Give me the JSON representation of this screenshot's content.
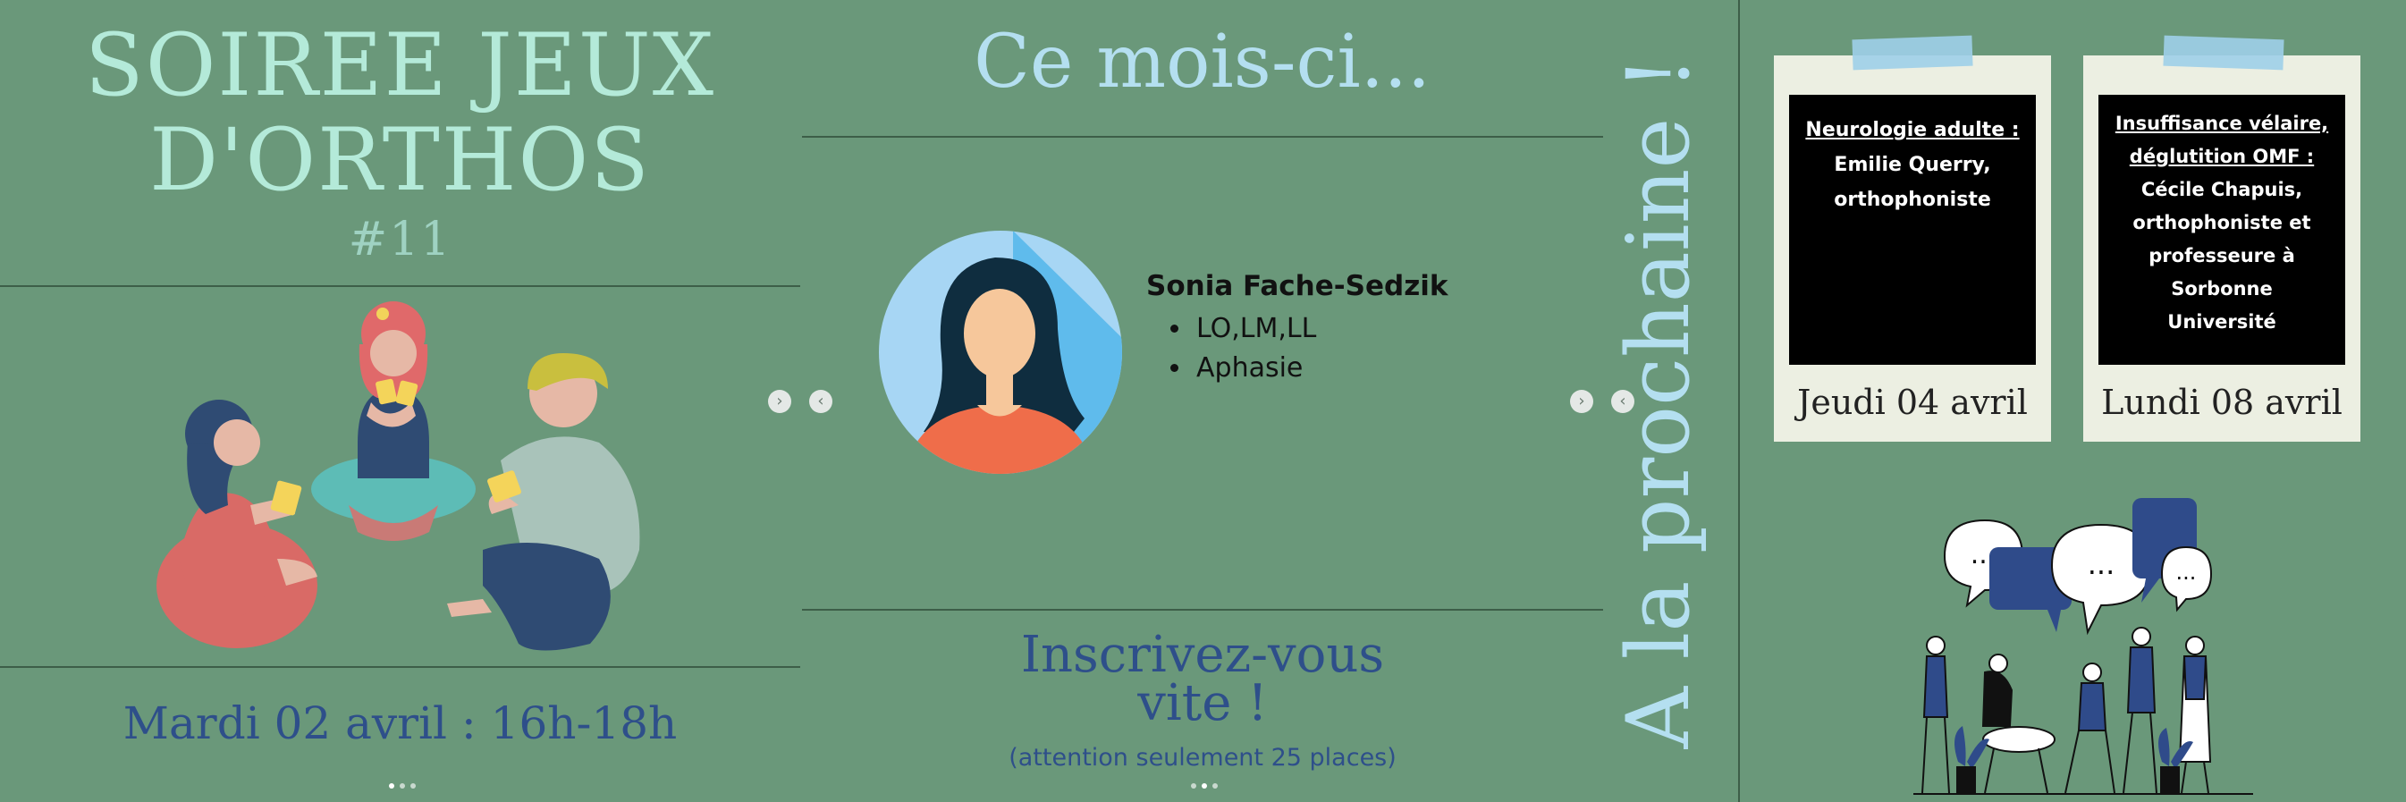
{
  "left_panel": {
    "title_line1": "SOIREE JEUX",
    "title_line2": "D'ORTHOS",
    "issue": "#11",
    "date": "Mardi 02 avril : 16h-18h"
  },
  "middle_panel": {
    "heading": "Ce mois-ci...",
    "speaker": {
      "name": "Sonia Fache-Sedzik",
      "items": [
        "LO,LM,LL",
        "Aphasie"
      ]
    },
    "signup_line1": "Inscrivez-vous",
    "signup_line2": "vite !",
    "note": "(attention seulement 25 places)"
  },
  "vertical_heading": "A la prochaine !",
  "upcoming": [
    {
      "topic": "Neurologie adulte :",
      "speaker_lines": [
        "Emilie Querry,",
        "orthophoniste"
      ],
      "date": "Jeudi 04 avril"
    },
    {
      "topic_lines": [
        "Insuffisance vélaire,",
        "déglutition OMF :"
      ],
      "speaker_lines": [
        "Cécile Chapuis,",
        "orthophoniste et",
        "professeure à Sorbonne",
        "Université"
      ],
      "date": "Lundi 08 avril"
    }
  ],
  "icons": {
    "prev": "chevron-left-icon",
    "next": "chevron-right-icon"
  },
  "colors": {
    "background": "#6a987a",
    "title": "#b4ead9",
    "accent_blue": "#2e4f8a",
    "light_blue": "#b4dff0"
  }
}
